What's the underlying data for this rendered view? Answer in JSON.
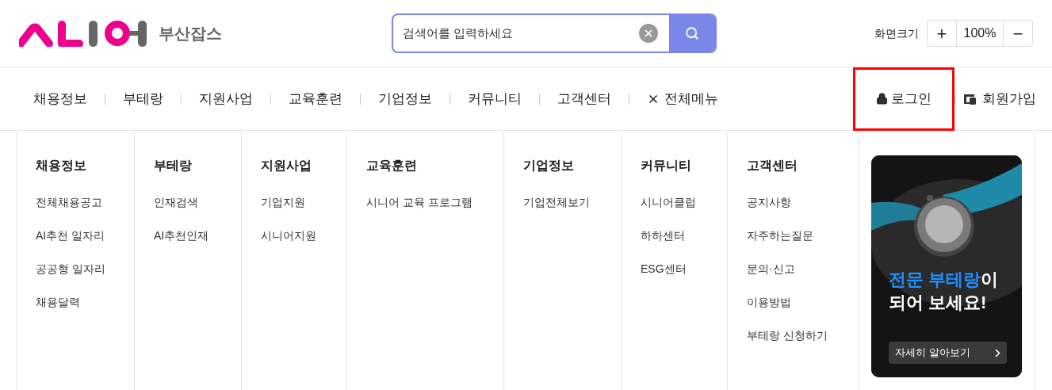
{
  "header": {
    "site_name": "부산잡스",
    "search": {
      "placeholder": "검색어를 입력하세요"
    },
    "zoom": {
      "label": "화면크기",
      "plus": "+",
      "value": "100%",
      "minus": "−"
    }
  },
  "nav": {
    "items": [
      "채용정보",
      "부테랑",
      "지원사업",
      "교육훈련",
      "기업정보",
      "커뮤니티",
      "고객센터"
    ],
    "all_menu": "전체메뉴",
    "login": {
      "label": "로그인",
      "highlighted": true
    },
    "signup": "회원가입"
  },
  "mega_menu": [
    {
      "title": "채용정보",
      "links": [
        "전체채용공고",
        "AI추천 일자리",
        "공공형 일자리",
        "채용달력"
      ]
    },
    {
      "title": "부테랑",
      "links": [
        "인재검색",
        "AI추천인재"
      ]
    },
    {
      "title": "지원사업",
      "links": [
        "기업지원",
        "시니어지원"
      ]
    },
    {
      "title": "교육훈련",
      "links": [
        "시니어 교육 프로그램"
      ]
    },
    {
      "title": "기업정보",
      "links": [
        "기업전체보기"
      ]
    },
    {
      "title": "커뮤니티",
      "links": [
        "시니어클럽",
        "하하센터",
        "ESG센터"
      ]
    },
    {
      "title": "고객센터",
      "links": [
        "공지사항",
        "자주하는질문",
        "문의·신고",
        "이용방법",
        "부테랑 신청하기"
      ]
    }
  ],
  "banner": {
    "kind": "picture",
    "headline_highlight": "전문 부테랑",
    "headline_rest": "이",
    "headline_line2": "되어 보세요!",
    "button": "자세히 알아보기"
  }
}
